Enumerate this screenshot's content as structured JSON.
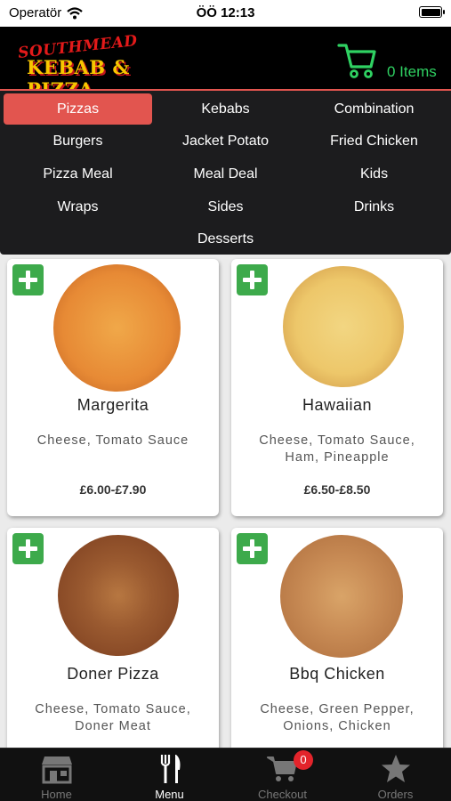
{
  "status_bar": {
    "carrier": "Operatör",
    "time": "ÖÖ 12:13"
  },
  "header": {
    "logo_top": "SOUTHMEAD",
    "logo_main": "KEBAB & PIZZA",
    "items_label": "0 Items",
    "icons": [
      "wifi-icon",
      "battery-icon",
      "cart-icon"
    ]
  },
  "categories": [
    "Pizzas",
    "Kebabs",
    "Combination",
    "Burgers",
    "Jacket Potato",
    "Fried Chicken",
    "Pizza Meal",
    "Meal Deal",
    "Kids",
    "Wraps",
    "Sides",
    "Drinks",
    "Desserts"
  ],
  "selected_category": "Pizzas",
  "products": [
    {
      "name": "Margerita",
      "desc": "Cheese, Tomato Sauce",
      "price": "£6.00-£7.90"
    },
    {
      "name": "Hawaiian",
      "desc": "Cheese, Tomato Sauce, Ham, Pineapple",
      "price": "£6.50-£8.50"
    },
    {
      "name": "Doner Pizza",
      "desc": "Cheese, Tomato Sauce, Doner Meat",
      "price": ""
    },
    {
      "name": "Bbq Chicken",
      "desc": "Cheese, Green Pepper, Onions, Chicken",
      "price": ""
    }
  ],
  "tabbar": {
    "tabs": [
      "Home",
      "Menu",
      "Checkout",
      "Orders"
    ],
    "active": "Menu",
    "checkout_badge": "0",
    "icons": [
      "store-icon",
      "fork-knife-icon",
      "cart-icon",
      "star-icon"
    ]
  },
  "colors": {
    "accent": "#e2554f",
    "cart_green": "#2fd162",
    "add_green": "#3daa4b",
    "badge_red": "#e3242b"
  }
}
